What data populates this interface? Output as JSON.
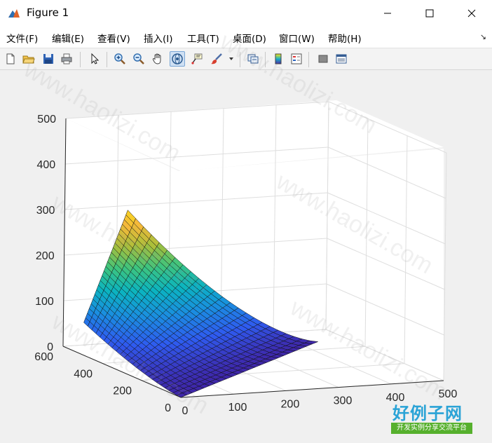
{
  "window": {
    "title": "Figure 1"
  },
  "menu": {
    "items": [
      {
        "label": "文件(F)"
      },
      {
        "label": "编辑(E)"
      },
      {
        "label": "查看(V)"
      },
      {
        "label": "插入(I)"
      },
      {
        "label": "工具(T)"
      },
      {
        "label": "桌面(D)"
      },
      {
        "label": "窗口(W)"
      },
      {
        "label": "帮助(H)"
      }
    ]
  },
  "toolbar": {
    "icons": [
      "new-figure-icon",
      "open-folder-icon",
      "save-icon",
      "print-icon",
      "pointer-icon",
      "zoom-in-icon",
      "zoom-out-icon",
      "pan-hand-icon",
      "rotate-3d-icon",
      "data-cursor-icon",
      "brush-icon",
      "link-plot-icon",
      "colorbar-icon",
      "legend-icon",
      "hide-plot-tools-icon",
      "show-plot-tools-icon"
    ],
    "active": "rotate-3d-icon"
  },
  "plot": {
    "z_ticks": [
      "0",
      "100",
      "200",
      "300",
      "400",
      "500"
    ],
    "y_ticks": [
      "0",
      "200",
      "400",
      "600"
    ],
    "x_ticks": [
      "0",
      "100",
      "200",
      "300",
      "400",
      "500"
    ],
    "colormap": [
      "#3e26a8",
      "#2f5bf0",
      "#1a8fe0",
      "#0bb4c0",
      "#3dc47e",
      "#a8bf3a",
      "#f5b93a",
      "#f9e614"
    ]
  },
  "chart_data": {
    "type": "surface",
    "xlim": [
      0,
      500
    ],
    "ylim": [
      0,
      600
    ],
    "zlim": [
      0,
      500
    ],
    "grid": "on",
    "colormap": "parula",
    "surface_corners": [
      {
        "x": 0,
        "y": 0,
        "z": 0
      },
      {
        "x": 20,
        "y": 550,
        "z": 60
      },
      {
        "x": 440,
        "y": 480,
        "z": 0
      },
      {
        "x": 120,
        "y": 600,
        "z": 290
      }
    ]
  },
  "watermark": {
    "text": "www.haolizi.com"
  },
  "logo": {
    "main": "好例子网",
    "sub": "开发实例分享交流平台"
  }
}
